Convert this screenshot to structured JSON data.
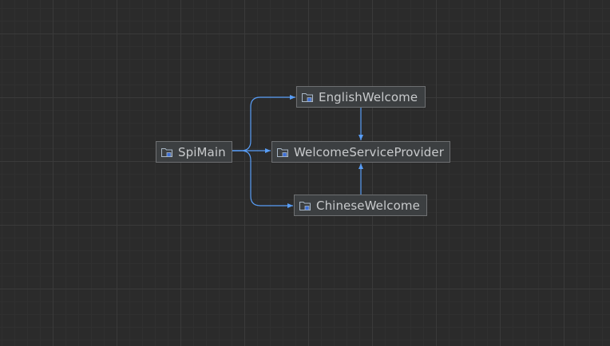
{
  "diagram": {
    "nodes": [
      {
        "id": "spimain",
        "label": "SpiMain",
        "icon": "package-icon"
      },
      {
        "id": "english",
        "label": "EnglishWelcome",
        "icon": "package-icon"
      },
      {
        "id": "provider",
        "label": "WelcomeServiceProvider",
        "icon": "package-icon"
      },
      {
        "id": "chinese",
        "label": "ChineseWelcome",
        "icon": "package-icon"
      }
    ],
    "edges": [
      {
        "from": "SpiMain",
        "to": "EnglishWelcome"
      },
      {
        "from": "SpiMain",
        "to": "WelcomeServiceProvider"
      },
      {
        "from": "SpiMain",
        "to": "ChineseWelcome"
      },
      {
        "from": "EnglishWelcome",
        "to": "WelcomeServiceProvider"
      },
      {
        "from": "ChineseWelcome",
        "to": "WelcomeServiceProvider"
      }
    ]
  },
  "colors": {
    "background": "#2b2b2b",
    "node_fill": "#3c3f41",
    "node_border": "#6e7072",
    "edge": "#589df6",
    "icon": "#a9b7c6",
    "icon_accent": "#3d6fd6"
  }
}
